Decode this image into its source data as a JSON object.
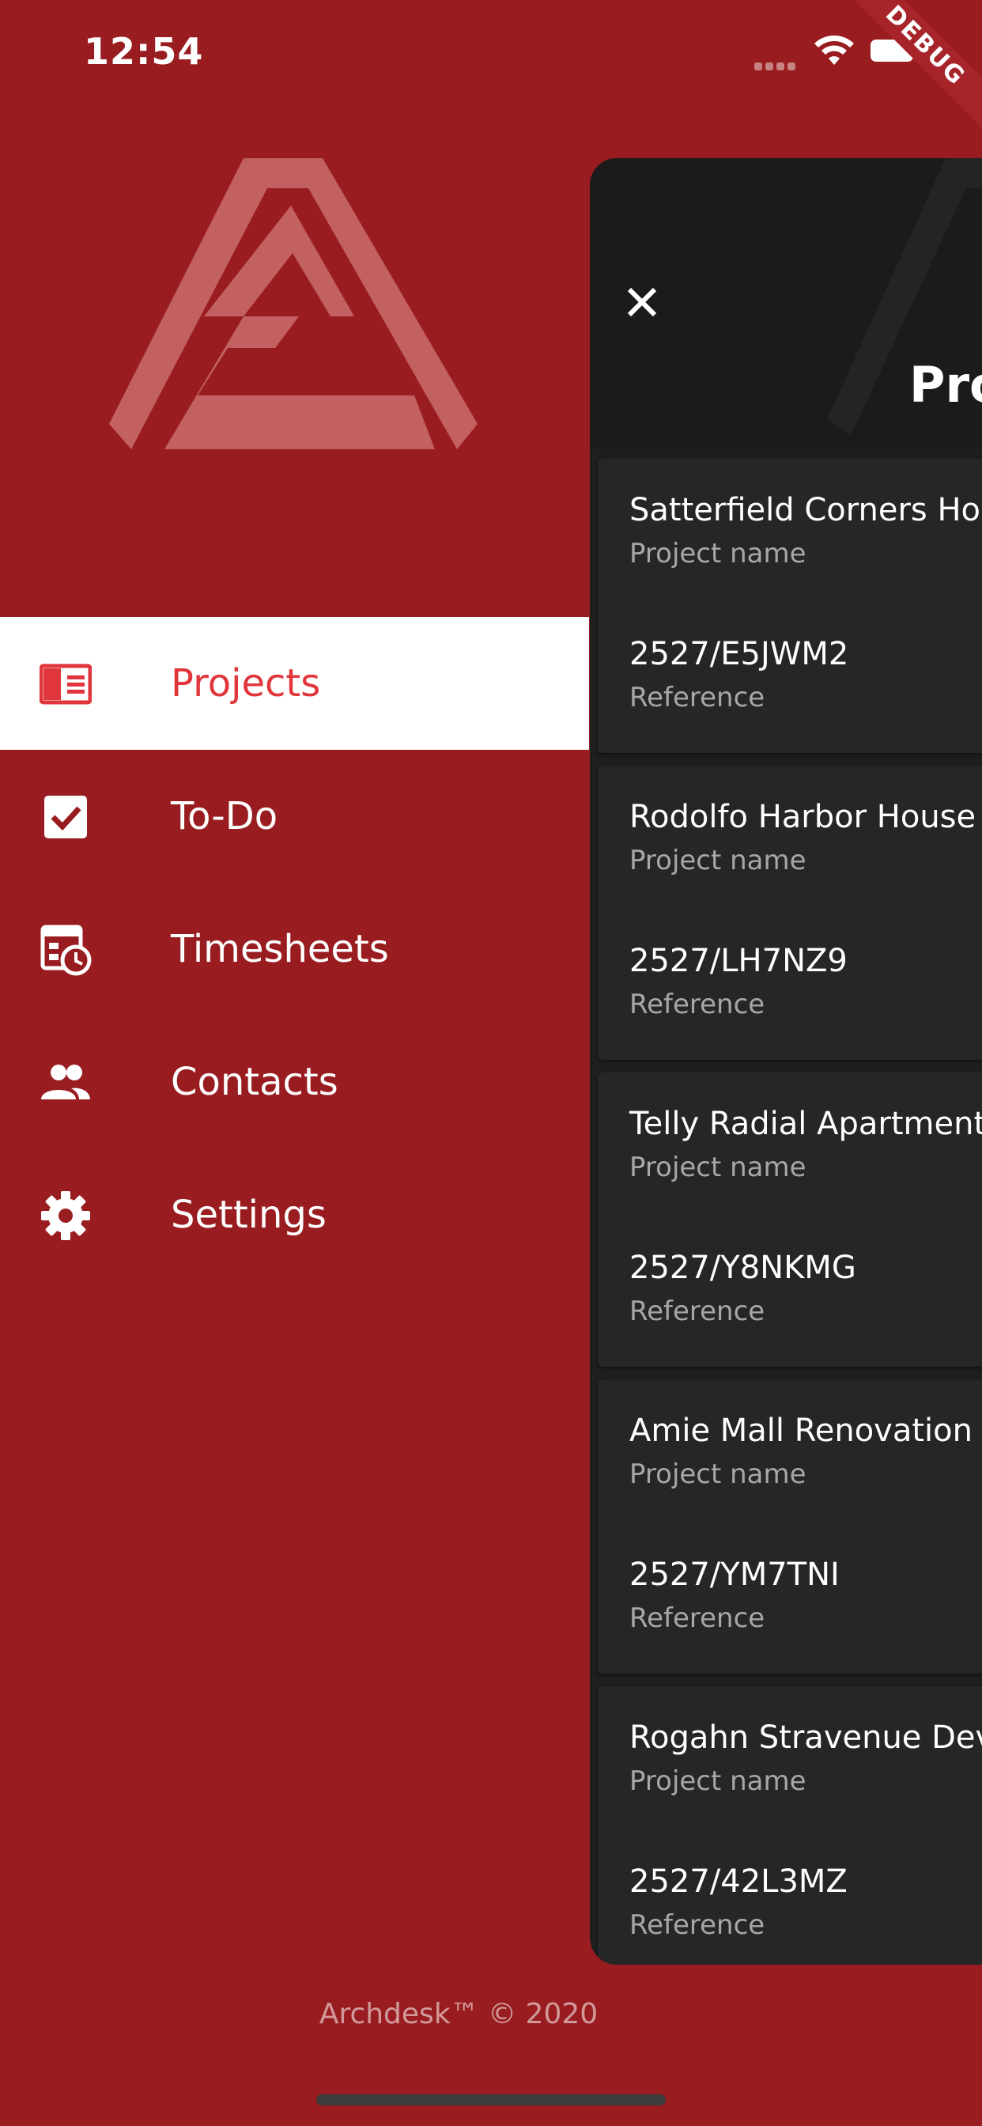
{
  "status_bar": {
    "time": "12:54"
  },
  "debug_banner": "DEBUG",
  "menu": {
    "items": [
      {
        "label": "Projects",
        "icon": "projects-icon",
        "active": true
      },
      {
        "label": "To-Do",
        "icon": "checkbox-icon",
        "active": false
      },
      {
        "label": "Timesheets",
        "icon": "timesheet-clock-icon",
        "active": false
      },
      {
        "label": "Contacts",
        "icon": "people-icon",
        "active": false
      },
      {
        "label": "Settings",
        "icon": "gear-icon",
        "active": false
      }
    ]
  },
  "footer": "Archdesk™ © 2020",
  "panel": {
    "title": "Projects",
    "projects": [
      {
        "name": "Satterfield Corners House",
        "name_label": "Project name",
        "reference": "2527/E5JWM2",
        "reference_label": "Reference"
      },
      {
        "name": "Rodolfo Harbor House",
        "name_label": "Project name",
        "reference": "2527/LH7NZ9",
        "reference_label": "Reference"
      },
      {
        "name": "Telly Radial Apartments",
        "name_label": "Project name",
        "reference": "2527/Y8NKMG",
        "reference_label": "Reference"
      },
      {
        "name": "Amie Mall Renovation",
        "name_label": "Project name",
        "reference": "2527/YM7TNI",
        "reference_label": "Reference"
      },
      {
        "name": "Rogahn Stravenue Development",
        "name_label": "Project name",
        "reference": "2527/42L3MZ",
        "reference_label": "Reference"
      }
    ]
  },
  "colors": {
    "background": "#991d20",
    "accent": "#e0353a",
    "panel": "#1f1f1f",
    "card": "#262626"
  }
}
